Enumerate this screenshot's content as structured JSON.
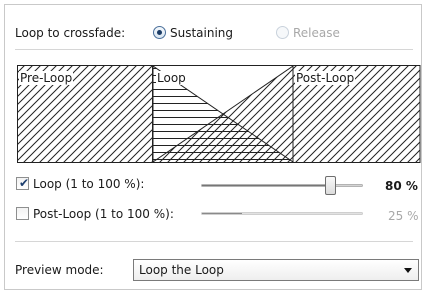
{
  "crossfade": {
    "label": "Loop to crossfade:",
    "options": [
      {
        "label": "Sustaining",
        "selected": true,
        "enabled": true
      },
      {
        "label": "Release",
        "selected": false,
        "enabled": false
      }
    ]
  },
  "diagram": {
    "pre_loop_label": "Pre-Loop",
    "loop_label": "Loop",
    "post_loop_label": "Post-Loop"
  },
  "loop_setting": {
    "label": "Loop (1 to 100 %):",
    "checked": true,
    "value_percent": 80,
    "value_text": "80 %"
  },
  "post_loop_setting": {
    "label": "Post-Loop (1 to 100 %):",
    "checked": false,
    "value_percent": 25,
    "value_text": "25 %"
  },
  "preview": {
    "label": "Preview mode:",
    "selected": "Loop the Loop"
  },
  "colors": {
    "disabled_text": "#a8a8a8",
    "separator": "#d6d6d6"
  }
}
